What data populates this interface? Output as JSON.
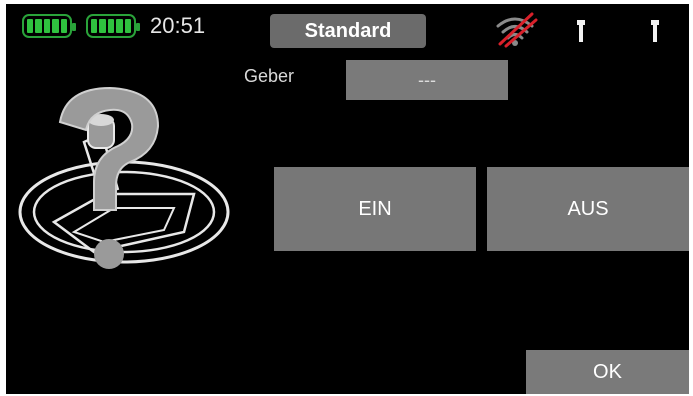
{
  "status_bar": {
    "time": "20:51",
    "model_name": "Standard",
    "colors": {
      "battery": "#2fc23f",
      "wireless": "#d8202a"
    },
    "icons": [
      "tx-battery-icon",
      "rx-battery-icon",
      "wireless-off-icon",
      "trim-icon",
      "trim-icon"
    ]
  },
  "geber": {
    "label": "Geber",
    "value": "---"
  },
  "buttons": {
    "ein": "EIN",
    "aus": "AUS",
    "ok": "OK"
  },
  "illustration": {
    "icon": "stick-question-mark-icon"
  }
}
